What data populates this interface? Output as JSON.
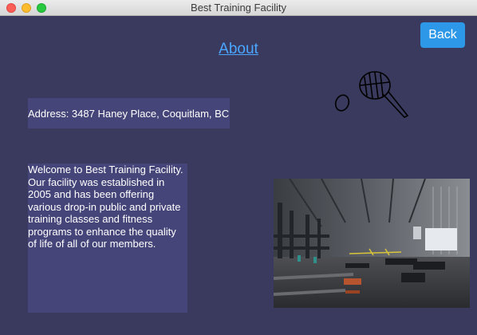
{
  "window": {
    "title": "Best Training Facility"
  },
  "header": {
    "back_label": "Back",
    "page_title": "About"
  },
  "address": {
    "text": "Address: 3487 Haney Place, Coquitlam, BC"
  },
  "welcome": {
    "text": "Welcome to Best Training Facility. Our facility was established in 2005 and has been offering various drop-in public and private training classes and fitness programs to enhance the quality of life of all of our members."
  },
  "logo": {
    "icon": "racket-and-ball-icon"
  },
  "photo": {
    "subject": "gym-interior-photo"
  },
  "colors": {
    "background": "#393a5e",
    "text_panel": "#45457a",
    "accent": "#2e98e8",
    "link": "#4aa6ff"
  }
}
